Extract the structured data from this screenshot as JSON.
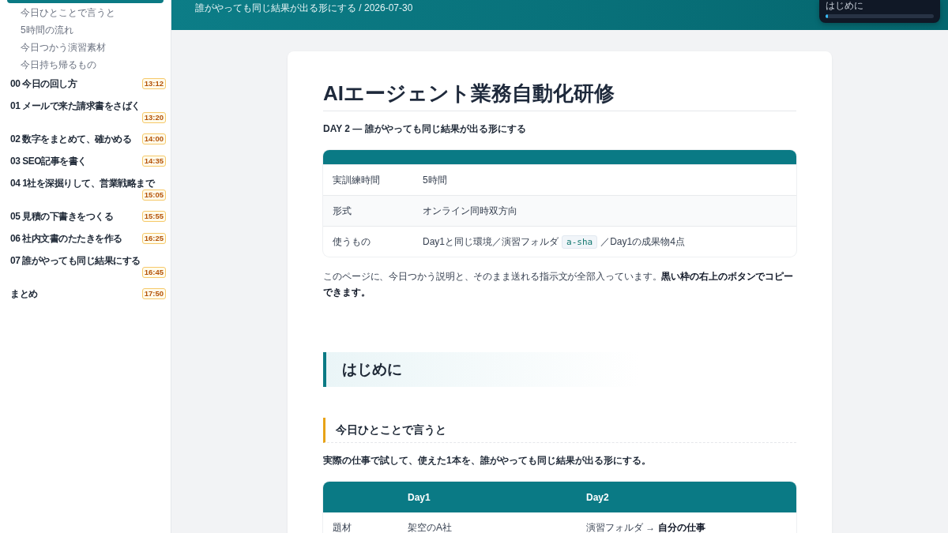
{
  "header": {
    "subtitle": "誰がやっても同じ結果が出る形にする / 2026-07-30"
  },
  "progress_widget": {
    "label": "はじめに",
    "level": 0.02
  },
  "sidebar": {
    "items": [
      {
        "selected": true,
        "children": [
          {
            "label": "今日ひとことで言うと",
            "selected": false
          },
          {
            "label": "5時間の流れ",
            "selected": false
          },
          {
            "label": "今日つかう演習素材",
            "selected": false
          },
          {
            "label": "今日持ち帰るもの",
            "selected": false
          }
        ]
      },
      {
        "label": "00 今日の回し方",
        "time": "13:12",
        "selected": false
      },
      {
        "label": "01 メールで来た請求書をさばく",
        "time": "13:20",
        "selected": false
      },
      {
        "label": "02 数字をまとめて、確かめる",
        "time": "14:00",
        "selected": false
      },
      {
        "label": "03 SEO記事を書く",
        "time": "14:35",
        "selected": false
      },
      {
        "label": "04 1社を深掘りして、営業戦略まで",
        "time": "15:05",
        "selected": false
      },
      {
        "label": "05 見積の下書きをつくる",
        "time": "15:55",
        "selected": false
      },
      {
        "label": "06 社内文書のたたきを作る",
        "time": "16:25",
        "selected": false
      },
      {
        "label": "07 誰がやっても同じ結果にする",
        "time": "16:45",
        "selected": false
      },
      {
        "label": "まとめ",
        "time": "17:50",
        "selected": false
      }
    ]
  },
  "document": {
    "title": "AIエージェント業務自動化研修",
    "subtitle": "DAY 2 — 誰がやっても同じ結果が出る形にする",
    "info_table": {
      "rows": [
        {
          "label": "実訓練時間",
          "value": [
            {
              "kind": "text",
              "text": "5時間"
            }
          ]
        },
        {
          "label": "形式",
          "value": [
            {
              "kind": "text",
              "text": "オンライン同時双方向"
            }
          ]
        },
        {
          "label": "使うもの",
          "value": [
            {
              "kind": "text",
              "text": "Day1と同じ環境／演習フォルダ"
            },
            {
              "kind": "code",
              "text": "a-sha"
            },
            {
              "kind": "text",
              "text": "／Day1の成果物4点"
            }
          ]
        }
      ]
    },
    "intro": "このページに、今日つかう説明と、そのまま送れる指示文が全部入っています。**黒い枠の右上のボタンでコピーできます。**",
    "section_heading": "はじめに",
    "subsection_heading": "今日ひとことで言うと",
    "summary": "実際の仕事で試して、使えた1本を、誰がやっても同じ結果が出る形にする。",
    "compare_table": {
      "columns": [
        "Day1",
        "Day2"
      ],
      "rows": [
        {
          "label": "題材",
          "cells": [
            "架空のA社",
            "演習フォルダ → **自分の仕事**"
          ]
        }
      ]
    }
  }
}
